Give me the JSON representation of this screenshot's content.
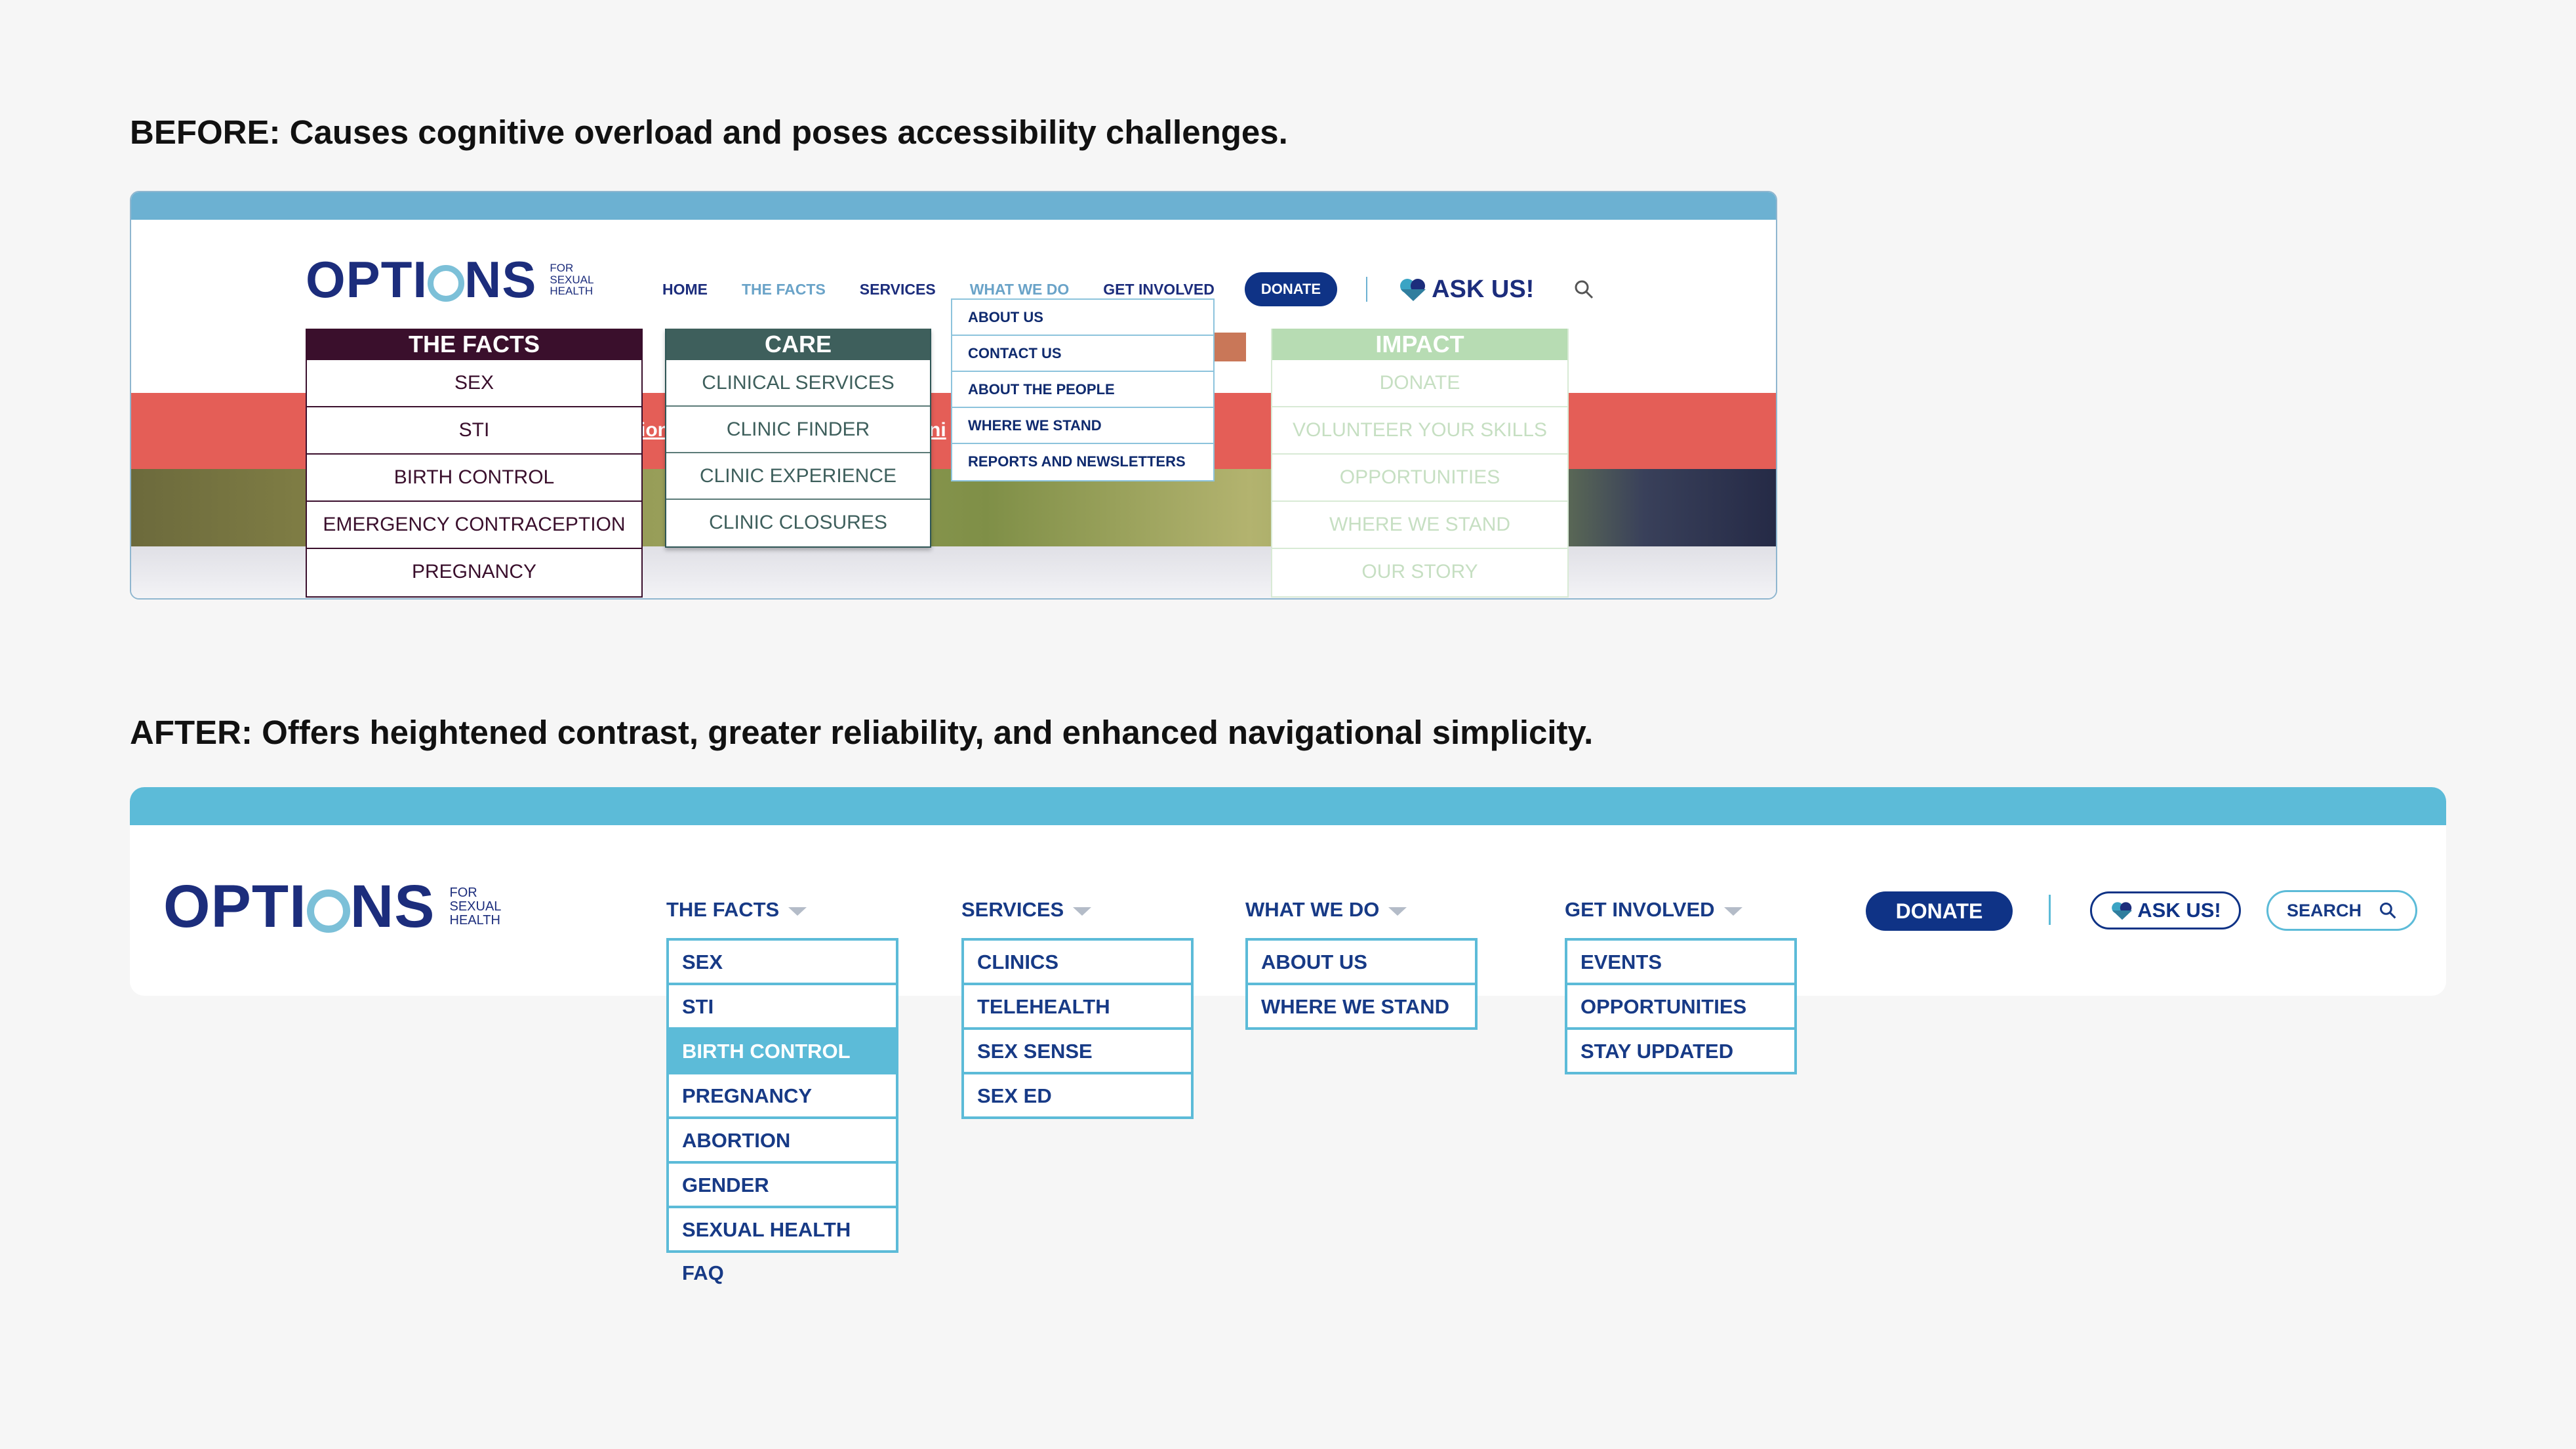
{
  "before": {
    "heading": "BEFORE: Causes cognitive overload and poses accessibility challenges.",
    "logo": {
      "word_left": "OPTI",
      "word_right": "NS",
      "sub": [
        "FOR",
        "SEXUAL",
        "HEALTH"
      ]
    },
    "nav": {
      "home": "HOME",
      "the_facts": "THE FACTS",
      "services": "SERVICES",
      "what_we_do": "WHAT WE DO",
      "get_involved": "GET INVOLVED",
      "donate": "DONATE",
      "ask_us": "ASK US!"
    },
    "hero_links": [
      "ion",
      "ni"
    ],
    "panels": {
      "the_facts": {
        "title": "THE FACTS",
        "items": [
          "SEX",
          "STI",
          "BIRTH CONTROL",
          "EMERGENCY CONTRACEPTION",
          "PREGNANCY"
        ]
      },
      "care": {
        "title": "CARE",
        "items": [
          "CLINICAL SERVICES",
          "CLINIC FINDER",
          "CLINIC EXPERIENCE",
          "CLINIC CLOSURES"
        ]
      },
      "what_we_do": {
        "items": [
          "ABOUT US",
          "CONTACT US",
          "ABOUT THE PEOPLE",
          "WHERE WE STAND",
          "REPORTS AND NEWSLETTERS"
        ]
      },
      "impact": {
        "title": "IMPACT",
        "items": [
          "DONATE",
          "VOLUNTEER YOUR SKILLS",
          "OPPORTUNITIES",
          "WHERE WE STAND",
          "OUR STORY"
        ]
      }
    },
    "colors": {
      "facts": "#3a0f2c",
      "care": "#3e5f5c",
      "impact": "#b7dcb3",
      "hero": "#e45e57",
      "topbar": "#6cb1d2"
    }
  },
  "after": {
    "heading": "AFTER: Offers heightened contrast, greater reliability, and enhanced navigational simplicity.",
    "logo": {
      "word_left": "OPTI",
      "word_right": "NS",
      "sub": [
        "FOR",
        "SEXUAL",
        "HEALTH"
      ]
    },
    "menus": {
      "the_facts": {
        "label": "THE FACTS",
        "items": [
          "SEX",
          "STI",
          "BIRTH CONTROL",
          "PREGNANCY",
          "ABORTION",
          "GENDER",
          "SEXUAL HEALTH FAQ"
        ],
        "active_item": "BIRTH CONTROL"
      },
      "services": {
        "label": "SERVICES",
        "items": [
          "CLINICS",
          "TELEHEALTH",
          "SEX SENSE",
          "SEX ED"
        ]
      },
      "what_we_do": {
        "label": "WHAT WE DO",
        "items": [
          "ABOUT US",
          "WHERE WE STAND"
        ]
      },
      "get_involved": {
        "label": "GET INVOLVED",
        "items": [
          "EVENTS",
          "OPPORTUNITIES",
          "STAY UPDATED"
        ]
      }
    },
    "donate": "DONATE",
    "ask_us": "ASK US!",
    "search": "SEARCH",
    "colors": {
      "accent": "#5cbbd8",
      "navy": "#0f3386",
      "text": "#173a86"
    }
  }
}
